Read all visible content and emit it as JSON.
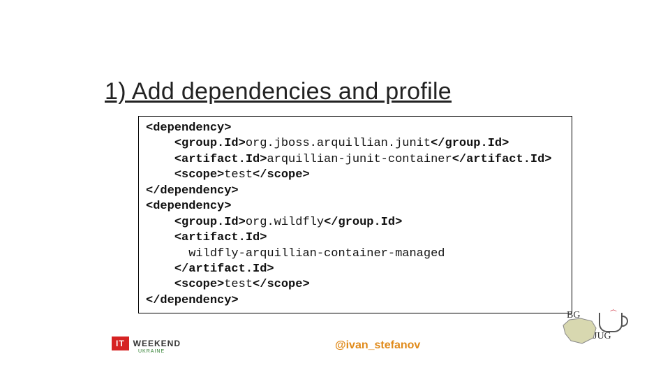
{
  "title": "1) Add dependencies and profile",
  "code": {
    "l1a": "<dependency>",
    "l2a": "<group.Id>",
    "l2b": "org.jboss.arquillian.junit",
    "l2c": "</group.Id>",
    "l3a": "<artifact.Id>",
    "l3b": "arquillian-junit-container",
    "l3c": "</artifact.Id>",
    "l4a": "<scope>",
    "l4b": "test",
    "l4c": "</scope>",
    "l5a": "</dependency>",
    "l6a": "<dependency>",
    "l7a": "<group.Id>",
    "l7b": "org.wildfly",
    "l7c": "</group.Id>",
    "l8a": "<artifact.Id>",
    "l9a": "wildfly-arquillian-container-managed",
    "l10a": "</artifact.Id>",
    "l11a": "<scope>",
    "l11b": "test",
    "l11c": "</scope>",
    "l12a": "</dependency>"
  },
  "handle": "@ivan_stefanov",
  "logos": {
    "it": "IT",
    "weekend": "WEEKEND",
    "ukraine": "UKRAINE",
    "bgjug": "BG",
    "jug": "JUG"
  }
}
